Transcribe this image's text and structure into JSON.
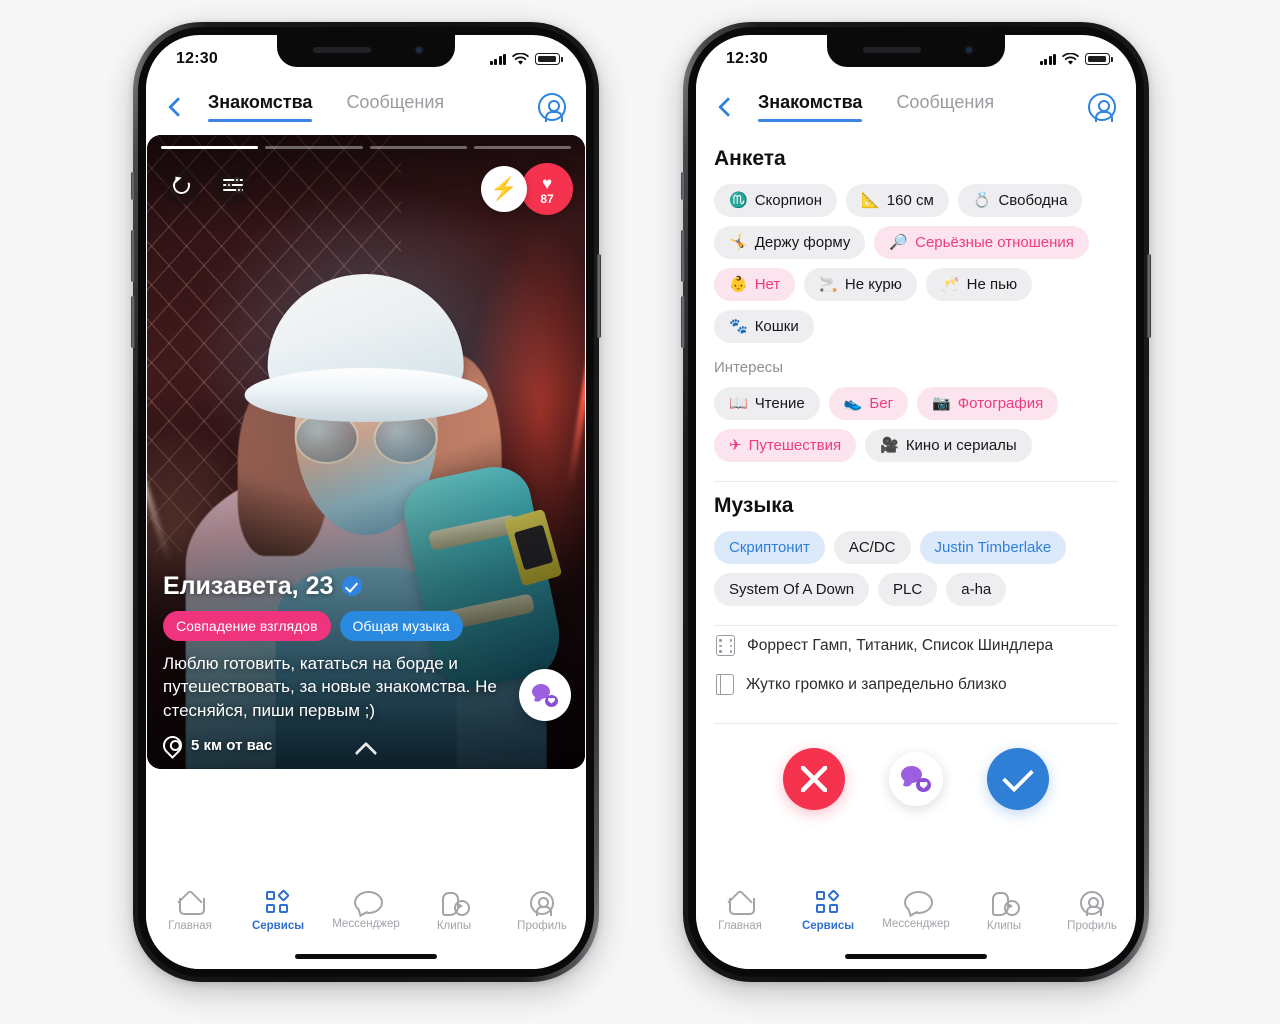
{
  "status_bar": {
    "time": "12:30",
    "signal_icon": "cellular-bars-icon",
    "wifi_icon": "wifi-icon",
    "battery_icon": "battery-icon"
  },
  "header": {
    "back_icon": "chevron-left-icon",
    "tabs": [
      {
        "label": "Знакомства",
        "active": true
      },
      {
        "label": "Сообщения",
        "active": false
      }
    ],
    "profile_icon": "account-circle-icon"
  },
  "card": {
    "story_segments": 4,
    "story_active_index": 0,
    "undo_icon": "undo-icon",
    "filter_icon": "sliders-icon",
    "boost_icon": "⚡",
    "likes_heart_icon": "♥",
    "likes_count": "87",
    "name": "Елизавета, 23",
    "verified_icon": "verified-check-icon",
    "badges": [
      {
        "label": "Совпадение взглядов",
        "color": "#f0337d"
      },
      {
        "label": "Общая музыка",
        "color": "#2a8adf"
      }
    ],
    "bio": "Люблю готовить, кататься на борде и путешествовать, за новые знакомства. Не стесняйся, пиши первым ;)",
    "location_icon": "location-pin-icon",
    "distance": "5 км от вас",
    "chat_fab_icon": "chat-heart-icon",
    "expand_icon": "chevron-up-icon"
  },
  "profile": {
    "section_anketa": "Анкета",
    "anketa_chips": [
      {
        "emoji": "♏",
        "label": "Скорпион",
        "style": "grey"
      },
      {
        "emoji": "📐",
        "label": "160 см",
        "style": "grey"
      },
      {
        "emoji": "💍",
        "label": "Свободна",
        "style": "grey"
      },
      {
        "emoji": "🤸",
        "label": "Держу форму",
        "style": "grey"
      },
      {
        "emoji": "🔎",
        "label": "Серьёзные отношения",
        "style": "pink"
      },
      {
        "emoji": "👶",
        "label": "Нет",
        "style": "pink"
      },
      {
        "emoji": "🚬",
        "label": "Не курю",
        "style": "grey"
      },
      {
        "emoji": "🥂",
        "label": "Не пью",
        "style": "grey"
      },
      {
        "emoji": "🐾",
        "label": "Кошки",
        "style": "grey"
      }
    ],
    "subsection_interests": "Интересы",
    "interest_chips": [
      {
        "emoji": "📖",
        "label": "Чтение",
        "style": "grey"
      },
      {
        "emoji": "👟",
        "label": "Бег",
        "style": "pink"
      },
      {
        "emoji": "📷",
        "label": "Фотография",
        "style": "pink"
      },
      {
        "emoji": "✈",
        "label": "Путешествия",
        "style": "pink"
      },
      {
        "emoji": "🎥",
        "label": "Кино и сериалы",
        "style": "grey"
      }
    ],
    "section_music": "Музыка",
    "music_chips": [
      {
        "label": "Скриптонит",
        "style": "blue"
      },
      {
        "label": "AC/DC",
        "style": "grey"
      },
      {
        "label": "Justin Timberlake",
        "style": "blue"
      },
      {
        "label": "System Of A Down",
        "style": "grey"
      },
      {
        "label": "PLC",
        "style": "grey"
      },
      {
        "label": "a-ha",
        "style": "grey"
      }
    ],
    "films_icon": "film-icon",
    "films": "Форрест Гамп, Титаник, Список Шиндлера",
    "books_icon": "book-icon",
    "books": "Жутко громко и запредельно близко",
    "actions": {
      "dislike_icon": "close-x-icon",
      "message_icon": "chat-heart-icon",
      "like_icon": "check-icon"
    }
  },
  "tabbar": [
    {
      "label": "Главная",
      "icon": "home-icon",
      "active": false
    },
    {
      "label": "Сервисы",
      "icon": "services-grid-icon",
      "active": true
    },
    {
      "label": "Мессенджер",
      "icon": "chat-bubble-icon",
      "active": false
    },
    {
      "label": "Клипы",
      "icon": "clips-play-icon",
      "active": false
    },
    {
      "label": "Профиль",
      "icon": "profile-circle-icon",
      "active": false
    }
  ]
}
